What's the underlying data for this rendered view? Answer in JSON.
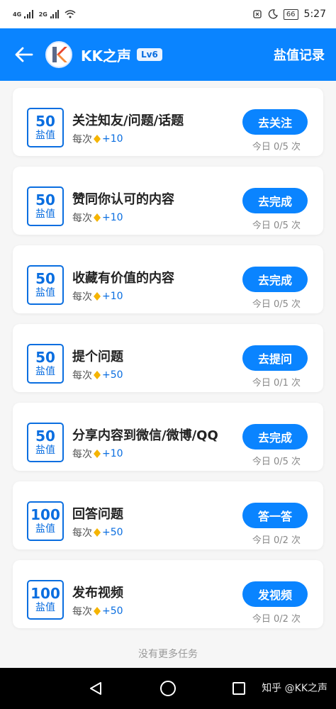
{
  "status_bar": {
    "net1": "4G",
    "net2": "2G",
    "battery": "66",
    "time": "5:27"
  },
  "header": {
    "name": "KK之声",
    "level": "Lv6",
    "records": "盐值记录"
  },
  "tasks": [
    {
      "points": "50",
      "unit": "盐值",
      "title": "关注知友/问题/话题",
      "reward_prefix": "每次",
      "reward_value": "+10",
      "button": "去关注",
      "progress": "今日 0/5 次"
    },
    {
      "points": "50",
      "unit": "盐值",
      "title": "赞同你认可的内容",
      "reward_prefix": "每次",
      "reward_value": "+10",
      "button": "去完成",
      "progress": "今日 0/5 次"
    },
    {
      "points": "50",
      "unit": "盐值",
      "title": "收藏有价值的内容",
      "reward_prefix": "每次",
      "reward_value": "+10",
      "button": "去完成",
      "progress": "今日 0/5 次"
    },
    {
      "points": "50",
      "unit": "盐值",
      "title": "提个问题",
      "reward_prefix": "每次",
      "reward_value": "+50",
      "button": "去提问",
      "progress": "今日 0/1 次"
    },
    {
      "points": "50",
      "unit": "盐值",
      "title": "分享内容到微信/微博/QQ",
      "reward_prefix": "每次",
      "reward_value": "+10",
      "button": "去完成",
      "progress": "今日 0/5 次"
    },
    {
      "points": "100",
      "unit": "盐值",
      "title": "回答问题",
      "reward_prefix": "每次",
      "reward_value": "+50",
      "button": "答一答",
      "progress": "今日 0/2 次"
    },
    {
      "points": "100",
      "unit": "盐值",
      "title": "发布视频",
      "reward_prefix": "每次",
      "reward_value": "+50",
      "button": "发视频",
      "progress": "今日 0/2 次"
    }
  ],
  "footer_text": "没有更多任务",
  "watermark": "知乎 @KK之声",
  "colors": {
    "accent": "#0a84ff",
    "accent_dark": "#0a6ee0",
    "salt_icon": "#f5b400"
  }
}
